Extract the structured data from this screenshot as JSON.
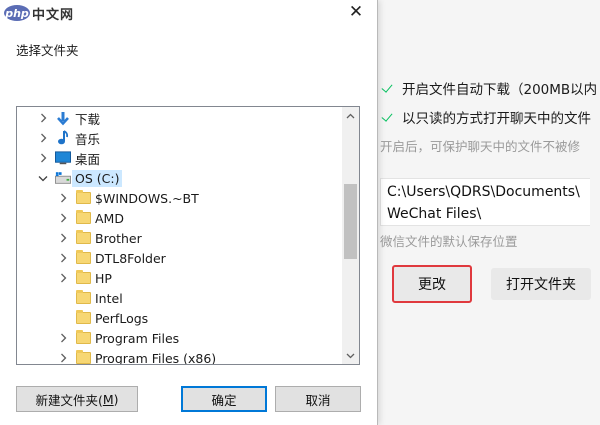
{
  "settings": {
    "auto_download_label": "开启文件自动下载（200MB以内",
    "readonly_label": "以只读的方式打开聊天中的文件",
    "readonly_hint": "开启后，可保护聊天中的文件不被修",
    "path_line1": "C:\\Users\\QDRS\\Documents\\",
    "path_line2": "WeChat Files\\",
    "path_hint": "微信文件的默认保存位置",
    "change_button": "更改",
    "open_folder_button": "打开文件夹",
    "accent_color": "#07c160",
    "highlight_color": "#e0393e"
  },
  "dialog": {
    "watermark_php": "php",
    "watermark_cn": "中文网",
    "close_label": "✕",
    "prompt": "选择文件夹",
    "tree": [
      {
        "label": "下载",
        "icon": "download-arrow-icon",
        "expanded": false
      },
      {
        "label": "音乐",
        "icon": "music-note-icon",
        "expanded": false
      },
      {
        "label": "桌面",
        "icon": "desktop-icon",
        "expanded": false
      },
      {
        "label": "OS (C:)",
        "icon": "drive-icon",
        "expanded": true,
        "selected": true
      },
      {
        "label": "$WINDOWS.~BT",
        "icon": "folder-icon",
        "expanded": false
      },
      {
        "label": "AMD",
        "icon": "folder-icon",
        "expanded": false
      },
      {
        "label": "Brother",
        "icon": "folder-icon",
        "expanded": false
      },
      {
        "label": "DTL8Folder",
        "icon": "folder-icon",
        "expanded": false
      },
      {
        "label": "HP",
        "icon": "folder-icon",
        "expanded": false
      },
      {
        "label": "Intel",
        "icon": "folder-icon",
        "expanded": null
      },
      {
        "label": "PerfLogs",
        "icon": "folder-icon",
        "expanded": null
      },
      {
        "label": "Program Files",
        "icon": "folder-icon",
        "expanded": false
      },
      {
        "label": "Program Files (x86)",
        "icon": "folder-icon",
        "expanded": false
      }
    ],
    "new_folder_button": "新建文件夹(",
    "new_folder_key": "M",
    "new_folder_close": ")",
    "ok_button": "确定",
    "cancel_button": "取消"
  }
}
